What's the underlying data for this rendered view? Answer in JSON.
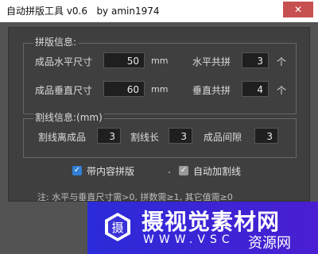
{
  "window": {
    "title": "自动拼版工具 v0.6   by amin1974",
    "close_glyph": "✕"
  },
  "layout": {
    "legend": "拼版信息:",
    "width_label": "成品水平尺寸",
    "width_value": "50",
    "width_unit": "mm",
    "height_label": "成品垂直尺寸",
    "height_value": "60",
    "height_unit": "mm",
    "hcount_label": "水平共拼",
    "hcount_value": "3",
    "hcount_unit": "个",
    "vcount_label": "垂直共拼",
    "vcount_value": "4",
    "vcount_unit": "个"
  },
  "cut": {
    "legend": "割线信息:(mm)",
    "offset_label": "割线离成品",
    "offset_value": "3",
    "length_label": "割线长",
    "length_value": "3",
    "gap_label": "成品间隙",
    "gap_value": "3"
  },
  "options": {
    "content_label": "带内容拼版",
    "content_checked": true,
    "auto_cut_label": "自动加割线",
    "auto_cut_checked": true,
    "check_glyph": "✓",
    "separator": "."
  },
  "note": "注: 水平与垂直尺寸需>0, 拼数需≥1, 其它值需≥0",
  "watermark": {
    "logo_char": "摄",
    "main": "摄视觉素材网",
    "url": "WWW.VSC",
    "brand": "资源网",
    "colors": {
      "bg": "#2b2bd9",
      "text": "#ffffff"
    }
  },
  "colors": {
    "panel": "#3f3f3f",
    "checkbox_blue": "#2f7fd6",
    "close": "#c75050"
  }
}
